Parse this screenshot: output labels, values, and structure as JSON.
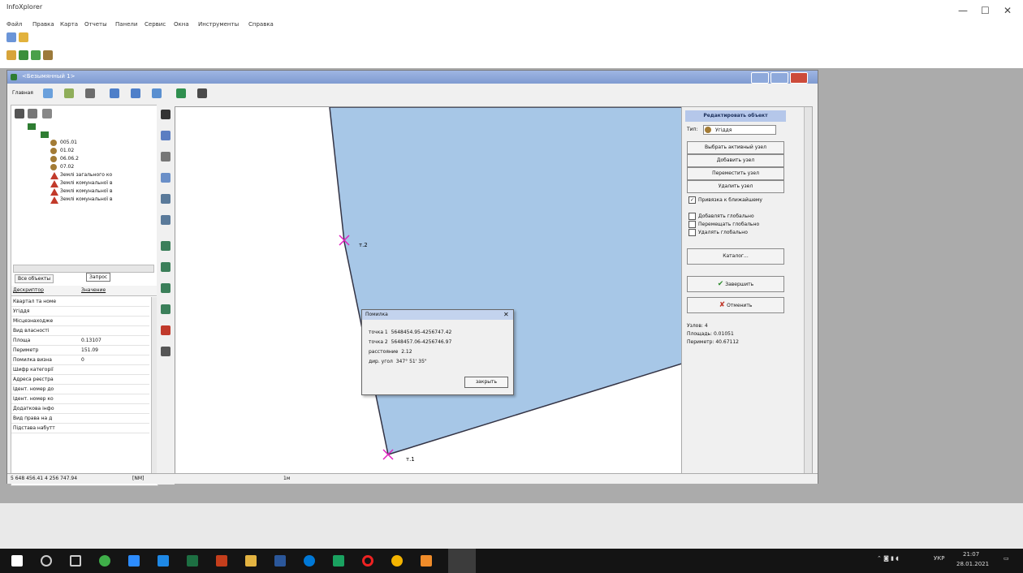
{
  "app": {
    "title": "InfoXplorer"
  },
  "menu": [
    "Файл",
    "Правка",
    "Карта",
    "Отчеты",
    "Панели",
    "Сервис",
    "Окна",
    "Инструменты",
    "Справка"
  ],
  "child": {
    "title": "<Безымянный 1>",
    "tab_label": "Главная"
  },
  "tree": {
    "items": [
      "005.01",
      "01.02",
      "06.06.2",
      "07.02"
    ],
    "warnings": [
      "Землі загального ко",
      "Землі комунальної в",
      "Землі комунальної в",
      "Землі комунальної в"
    ]
  },
  "props": {
    "tabs": [
      "Все объекты",
      "Запрос"
    ],
    "header": {
      "col1": "Дескриптор",
      "col2": "Значение"
    },
    "rows": [
      {
        "label": "Квартал та номе",
        "value": ""
      },
      {
        "label": "Угіддя",
        "value": ""
      },
      {
        "label": "Місцезнаходже",
        "value": ""
      },
      {
        "label": "Вид власності",
        "value": ""
      },
      {
        "label": "Площа",
        "value": "0.13107"
      },
      {
        "label": "Периметр",
        "value": "151.09"
      },
      {
        "label": "Помилка визна",
        "value": "0"
      },
      {
        "label": "Шифр категорії",
        "value": ""
      },
      {
        "label": "Адреса реєстра",
        "value": ""
      },
      {
        "label": "Ідент. номер до",
        "value": ""
      },
      {
        "label": "Ідент. номер ко",
        "value": ""
      },
      {
        "label": "Додаткова інфо",
        "value": ""
      },
      {
        "label": "Вид права на д",
        "value": ""
      },
      {
        "label": "Підстава набутт",
        "value": ""
      }
    ]
  },
  "map": {
    "fill_color": "#a7c7e7",
    "points": [
      {
        "label": "т.2"
      },
      {
        "label": "т.1"
      }
    ]
  },
  "dialog": {
    "title": "Помилка",
    "rows": [
      {
        "label": "точка 1",
        "value": "5648454.95-4256747.42"
      },
      {
        "label": "точка 2",
        "value": "5648457.06-4256746.97"
      },
      {
        "label": "расстояние",
        "value": "2.12"
      },
      {
        "label": "дир. угол",
        "value": "347° 51' 35\""
      }
    ],
    "close_label": "закрыть"
  },
  "right_panel": {
    "title": "Редактировать объект",
    "type_label": "Тип:",
    "type_value": "Угіддя",
    "buttons": [
      "Выбрать активный узел",
      "Добавить узел",
      "Переместить узел",
      "Удалить узел"
    ],
    "snap_label": "Привязка к ближайшему",
    "checks": [
      "Добавлять глобально",
      "Перемещать глобально",
      "Удалять глобально"
    ],
    "catalog": "Каталог...",
    "finish": "Завершить",
    "cancel": "Отменить",
    "stats": [
      "Узлов: 4",
      "Площадь: 0.01051",
      "Периметр: 40.67112"
    ]
  },
  "statusbar": {
    "coords": "5 648 456.41  4 256 747.94",
    "mode": "[NM]",
    "scale": "1м"
  },
  "tray": {
    "time": "21:07",
    "date": "28.01.2021",
    "lang": "УКР"
  }
}
